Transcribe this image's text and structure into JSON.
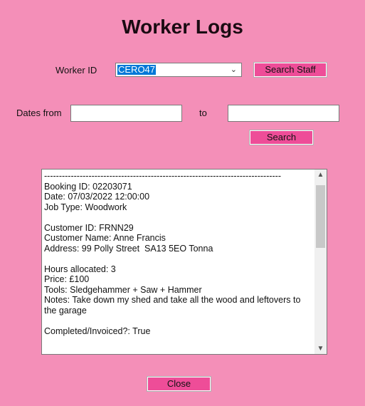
{
  "window": {
    "title": "Worker Logs"
  },
  "worker": {
    "label": "Worker ID",
    "selected": "CERO47",
    "search_button": "Search Staff"
  },
  "dates": {
    "from_label": "Dates from",
    "to_label": "to",
    "from_value": "",
    "to_value": "",
    "search_button": "Search"
  },
  "log": {
    "text": "--------------------------------------------------------------------------------\nBooking ID: 02203071\nDate: 07/03/2022 12:00:00\nJob Type: Woodwork\n\nCustomer ID: FRNN29\nCustomer Name: Anne Francis\nAddress: 99 Polly Street  SA13 5EO Tonna\n\nHours allocated: 3\nPrice: £100\nTools: Sledgehammer + Saw + Hammer\nNotes: Take down my shed and take all the wood and leftovers to the garage\n\nCompleted/Invoiced?: True"
  },
  "footer": {
    "close_button": "Close"
  },
  "icons": {
    "dropdown": "chevron-down-icon",
    "scroll_up": "scroll-up-icon",
    "scroll_down": "scroll-down-icon"
  },
  "colors": {
    "background": "#f48fb8",
    "button": "#ee4d98",
    "selection": "#0078d7"
  }
}
